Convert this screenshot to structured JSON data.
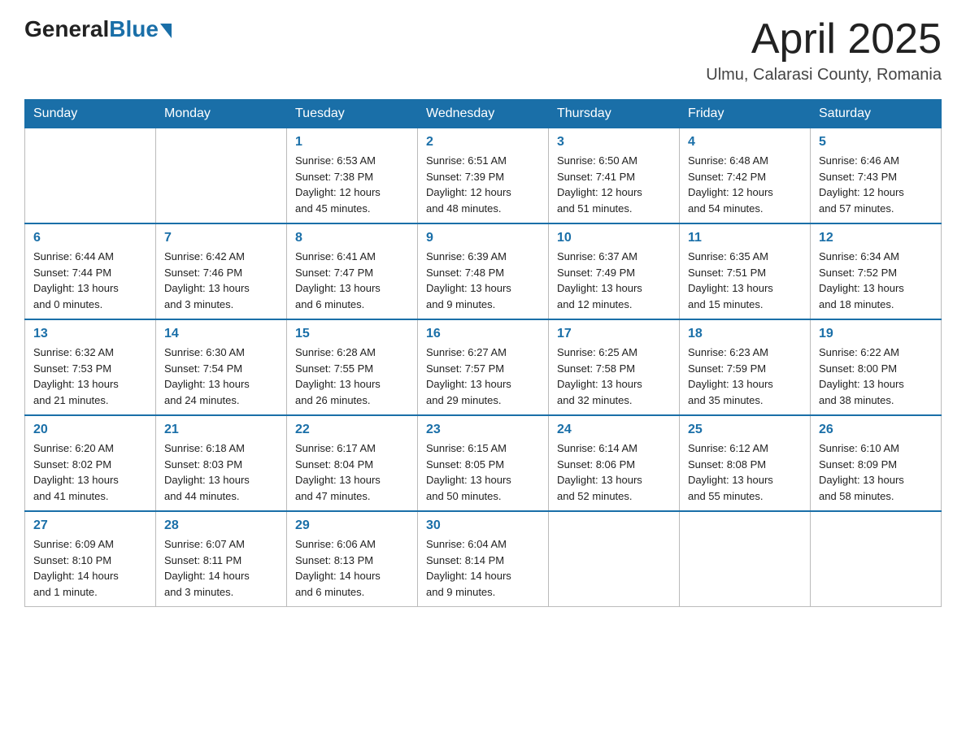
{
  "header": {
    "logo_general": "General",
    "logo_blue": "Blue",
    "month_title": "April 2025",
    "subtitle": "Ulmu, Calarasi County, Romania"
  },
  "days_of_week": [
    "Sunday",
    "Monday",
    "Tuesday",
    "Wednesday",
    "Thursday",
    "Friday",
    "Saturday"
  ],
  "weeks": [
    [
      {
        "day": "",
        "info": ""
      },
      {
        "day": "",
        "info": ""
      },
      {
        "day": "1",
        "info": "Sunrise: 6:53 AM\nSunset: 7:38 PM\nDaylight: 12 hours\nand 45 minutes."
      },
      {
        "day": "2",
        "info": "Sunrise: 6:51 AM\nSunset: 7:39 PM\nDaylight: 12 hours\nand 48 minutes."
      },
      {
        "day": "3",
        "info": "Sunrise: 6:50 AM\nSunset: 7:41 PM\nDaylight: 12 hours\nand 51 minutes."
      },
      {
        "day": "4",
        "info": "Sunrise: 6:48 AM\nSunset: 7:42 PM\nDaylight: 12 hours\nand 54 minutes."
      },
      {
        "day": "5",
        "info": "Sunrise: 6:46 AM\nSunset: 7:43 PM\nDaylight: 12 hours\nand 57 minutes."
      }
    ],
    [
      {
        "day": "6",
        "info": "Sunrise: 6:44 AM\nSunset: 7:44 PM\nDaylight: 13 hours\nand 0 minutes."
      },
      {
        "day": "7",
        "info": "Sunrise: 6:42 AM\nSunset: 7:46 PM\nDaylight: 13 hours\nand 3 minutes."
      },
      {
        "day": "8",
        "info": "Sunrise: 6:41 AM\nSunset: 7:47 PM\nDaylight: 13 hours\nand 6 minutes."
      },
      {
        "day": "9",
        "info": "Sunrise: 6:39 AM\nSunset: 7:48 PM\nDaylight: 13 hours\nand 9 minutes."
      },
      {
        "day": "10",
        "info": "Sunrise: 6:37 AM\nSunset: 7:49 PM\nDaylight: 13 hours\nand 12 minutes."
      },
      {
        "day": "11",
        "info": "Sunrise: 6:35 AM\nSunset: 7:51 PM\nDaylight: 13 hours\nand 15 minutes."
      },
      {
        "day": "12",
        "info": "Sunrise: 6:34 AM\nSunset: 7:52 PM\nDaylight: 13 hours\nand 18 minutes."
      }
    ],
    [
      {
        "day": "13",
        "info": "Sunrise: 6:32 AM\nSunset: 7:53 PM\nDaylight: 13 hours\nand 21 minutes."
      },
      {
        "day": "14",
        "info": "Sunrise: 6:30 AM\nSunset: 7:54 PM\nDaylight: 13 hours\nand 24 minutes."
      },
      {
        "day": "15",
        "info": "Sunrise: 6:28 AM\nSunset: 7:55 PM\nDaylight: 13 hours\nand 26 minutes."
      },
      {
        "day": "16",
        "info": "Sunrise: 6:27 AM\nSunset: 7:57 PM\nDaylight: 13 hours\nand 29 minutes."
      },
      {
        "day": "17",
        "info": "Sunrise: 6:25 AM\nSunset: 7:58 PM\nDaylight: 13 hours\nand 32 minutes."
      },
      {
        "day": "18",
        "info": "Sunrise: 6:23 AM\nSunset: 7:59 PM\nDaylight: 13 hours\nand 35 minutes."
      },
      {
        "day": "19",
        "info": "Sunrise: 6:22 AM\nSunset: 8:00 PM\nDaylight: 13 hours\nand 38 minutes."
      }
    ],
    [
      {
        "day": "20",
        "info": "Sunrise: 6:20 AM\nSunset: 8:02 PM\nDaylight: 13 hours\nand 41 minutes."
      },
      {
        "day": "21",
        "info": "Sunrise: 6:18 AM\nSunset: 8:03 PM\nDaylight: 13 hours\nand 44 minutes."
      },
      {
        "day": "22",
        "info": "Sunrise: 6:17 AM\nSunset: 8:04 PM\nDaylight: 13 hours\nand 47 minutes."
      },
      {
        "day": "23",
        "info": "Sunrise: 6:15 AM\nSunset: 8:05 PM\nDaylight: 13 hours\nand 50 minutes."
      },
      {
        "day": "24",
        "info": "Sunrise: 6:14 AM\nSunset: 8:06 PM\nDaylight: 13 hours\nand 52 minutes."
      },
      {
        "day": "25",
        "info": "Sunrise: 6:12 AM\nSunset: 8:08 PM\nDaylight: 13 hours\nand 55 minutes."
      },
      {
        "day": "26",
        "info": "Sunrise: 6:10 AM\nSunset: 8:09 PM\nDaylight: 13 hours\nand 58 minutes."
      }
    ],
    [
      {
        "day": "27",
        "info": "Sunrise: 6:09 AM\nSunset: 8:10 PM\nDaylight: 14 hours\nand 1 minute."
      },
      {
        "day": "28",
        "info": "Sunrise: 6:07 AM\nSunset: 8:11 PM\nDaylight: 14 hours\nand 3 minutes."
      },
      {
        "day": "29",
        "info": "Sunrise: 6:06 AM\nSunset: 8:13 PM\nDaylight: 14 hours\nand 6 minutes."
      },
      {
        "day": "30",
        "info": "Sunrise: 6:04 AM\nSunset: 8:14 PM\nDaylight: 14 hours\nand 9 minutes."
      },
      {
        "day": "",
        "info": ""
      },
      {
        "day": "",
        "info": ""
      },
      {
        "day": "",
        "info": ""
      }
    ]
  ]
}
